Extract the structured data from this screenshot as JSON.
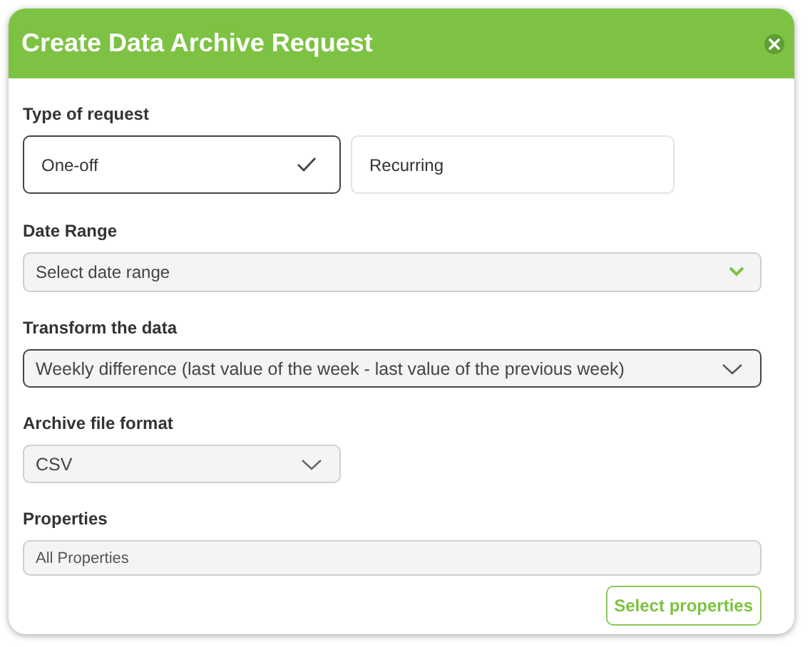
{
  "dialog": {
    "title": "Create Data Archive Request"
  },
  "request_type": {
    "label": "Type of request",
    "options": [
      {
        "label": "One-off",
        "selected": true
      },
      {
        "label": "Recurring",
        "selected": false
      }
    ]
  },
  "date_range": {
    "label": "Date Range",
    "placeholder": "Select date range"
  },
  "transform": {
    "label": "Transform the data",
    "value": "Weekly difference (last value of the week - last value of the previous week)"
  },
  "file_format": {
    "label": "Archive file format",
    "value": "CSV"
  },
  "properties": {
    "label": "Properties",
    "value": "All Properties"
  },
  "select_button": {
    "label": "Select properties"
  }
}
